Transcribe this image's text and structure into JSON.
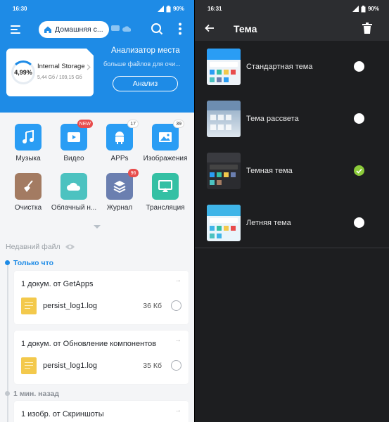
{
  "left": {
    "status": {
      "time": "16:30",
      "battery": "90%"
    },
    "toolbar": {
      "location": "Домашняя с..."
    },
    "storage": {
      "percent": "4,99%",
      "name": "Internal Storage",
      "size": "5,44 Gб / 109,15 Gб"
    },
    "analyzer": {
      "title": "Анализатор места",
      "subtitle": "больше файлов для очи...",
      "button": "Анализ"
    },
    "categories": [
      {
        "label": "Музыка",
        "color": "#2a9df4",
        "icon": "music-icon",
        "badge": "",
        "badge_style": ""
      },
      {
        "label": "Видео",
        "color": "#2a9df4",
        "icon": "video-icon",
        "badge": "NEW",
        "badge_style": "red"
      },
      {
        "label": "APPs",
        "color": "#2a9df4",
        "icon": "android-icon",
        "badge": "17",
        "badge_style": "white"
      },
      {
        "label": "Изображения",
        "color": "#2a9df4",
        "icon": "image-icon",
        "badge": "39",
        "badge_style": "white"
      },
      {
        "label": "Очистка",
        "color": "#a37b62",
        "icon": "broom-icon",
        "badge": "",
        "badge_style": ""
      },
      {
        "label": "Облачный н...",
        "color": "#4cc2c0",
        "icon": "cloud-icon",
        "badge": "",
        "badge_style": ""
      },
      {
        "label": "Журнал",
        "color": "#6b7fb0",
        "icon": "stack-icon",
        "badge": "96",
        "badge_style": "red"
      },
      {
        "label": "Трансляция",
        "color": "#34c0a4",
        "icon": "cast-icon",
        "badge": "",
        "badge_style": ""
      }
    ],
    "recent": {
      "header": "Недавний файл",
      "groups": [
        {
          "label": "Только что",
          "color": "#1e8be6"
        },
        {
          "label": "1 мин. назад",
          "color": "#8a8f96"
        }
      ],
      "cards": [
        {
          "title": "1 докум. от GetApps",
          "file": "persist_log1.log",
          "size": "36 Кб"
        },
        {
          "title": "1 докум. от Обновление компонентов",
          "file": "persist_log1.log",
          "size": "35 Кб"
        },
        {
          "title": "1 изобр. от Скриншоты"
        }
      ]
    }
  },
  "right": {
    "status": {
      "time": "16:31",
      "battery": "90%"
    },
    "title": "Тема",
    "themes": [
      {
        "label": "Стандартная тема",
        "selected": false
      },
      {
        "label": "Тема рассвета",
        "selected": false
      },
      {
        "label": "Темная тема",
        "selected": true
      },
      {
        "label": "Летняя тема",
        "selected": false
      }
    ]
  },
  "colors": {
    "accent": "#1e8be6",
    "selected": "#8ccb3a",
    "dark_bg": "#1d1e20"
  }
}
